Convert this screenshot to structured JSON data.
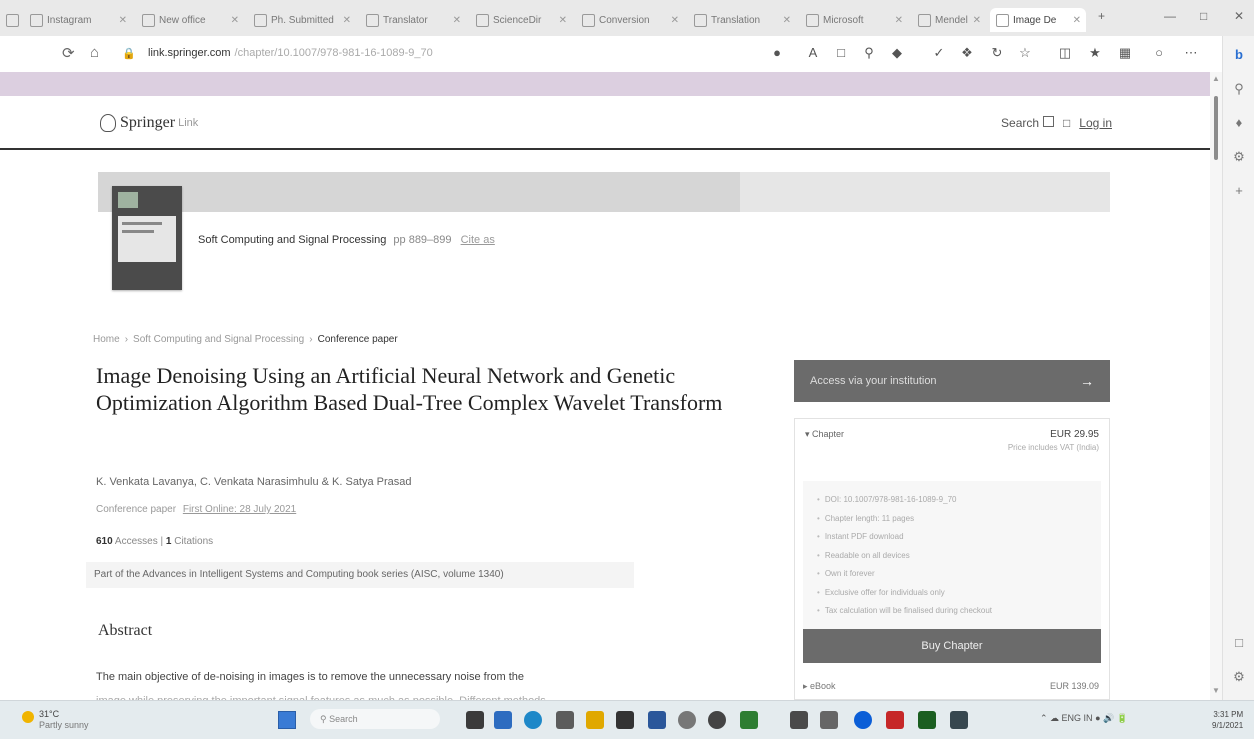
{
  "browser": {
    "tabs": [
      {
        "title": "Instagram",
        "active": false
      },
      {
        "title": "New office",
        "active": false
      },
      {
        "title": "Ph. Submitted",
        "active": false
      },
      {
        "title": "Translator",
        "active": false
      },
      {
        "title": "ScienceDir",
        "active": false
      },
      {
        "title": "Conversion",
        "active": false
      },
      {
        "title": "Translation",
        "active": false
      },
      {
        "title": "Microsoft",
        "active": false
      },
      {
        "title": "Mendeley",
        "active": false
      },
      {
        "title": "Image De",
        "active": true
      }
    ],
    "new_tab": "+",
    "url_domain": "link.springer.com",
    "url_path": "/chapter/10.1007/978-981-16-1089-9_70"
  },
  "site": {
    "logo_text": "Springer",
    "logo_sub": "Link",
    "search_label": "Search",
    "login_label": "Log in"
  },
  "book": {
    "title": "Soft Computing and Signal Processing",
    "pages": "pp 889–899",
    "cite_label": "Cite as"
  },
  "breadcrumb": {
    "home": "Home",
    "parent": "Soft Computing and Signal Processing",
    "current": "Conference paper"
  },
  "article": {
    "title": "Image Denoising Using an Artificial Neural Network and Genetic Optimization Algorithm Based Dual-Tree Complex Wavelet Transform",
    "authors": "K. Venkata Lavanya, C. Venkata Narasimhulu & K. Satya Prasad",
    "conf_label": "Conference paper",
    "first_online": "First Online: 28 July 2021",
    "accesses_count": "610",
    "accesses_label": "Accesses",
    "citations_count": "1",
    "citations_label": "Citations",
    "series": "Part of the Advances in Intelligent Systems and Computing book series (AISC, volume 1340)"
  },
  "abstract": {
    "heading": "Abstract",
    "line1": "The main objective of de-noising in images is to remove the unnecessary noise from the",
    "line2": "image while preserving the important signal features as much as possible. Different methods"
  },
  "access": {
    "institution_label": "Access via your institution",
    "chapter_label": "Chapter",
    "price": "EUR 29.95",
    "tax_note": "Price includes VAT (India)",
    "features": [
      "DOI: 10.1007/978-981-16-1089-9_70",
      "Chapter length: 11 pages",
      "Instant PDF download",
      "Readable on all devices",
      "Own it forever",
      "Exclusive offer for individuals only",
      "Tax calculation will be finalised during checkout"
    ],
    "buy_label": "Buy Chapter",
    "ebook_label": "eBook",
    "ebook_price": "EUR 139.09"
  },
  "taskbar": {
    "weather_temp": "31°C",
    "weather_cond": "Partly sunny",
    "search_placeholder": "Search",
    "lang": "ENG IN",
    "time": "3:31 PM",
    "date": "9/1/2021"
  },
  "colors": {
    "announce_bar": "#dccfe0",
    "button_gray": "#6b6b6b",
    "taskbar": "#e4ebee"
  }
}
